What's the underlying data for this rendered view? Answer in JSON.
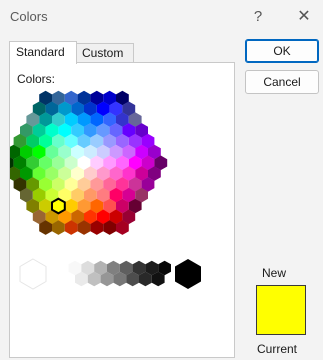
{
  "window": {
    "title": "Colors",
    "help_glyph": "?",
    "close_glyph": "✕"
  },
  "tabs": [
    {
      "label": "Standard",
      "active": true
    },
    {
      "label": "Custom",
      "active": false
    }
  ],
  "palette": {
    "label": "Colors:",
    "selected_color": "#ffff00",
    "hex_rows": [
      [
        "#003366",
        "#336699",
        "#3366cc",
        "#003399",
        "#000099",
        "#0000cc",
        "#000066"
      ],
      [
        "#006666",
        "#006699",
        "#0099cc",
        "#0066cc",
        "#0033cc",
        "#0000ff",
        "#3333ff",
        "#333399"
      ],
      [
        "#669999",
        "#009999",
        "#33cccc",
        "#00ccff",
        "#0099ff",
        "#0066ff",
        "#3366ff",
        "#3333cc",
        "#666699"
      ],
      [
        "#339966",
        "#00cc99",
        "#00ffcc",
        "#00ffff",
        "#33ccff",
        "#3399ff",
        "#6699ff",
        "#6666ff",
        "#6600ff",
        "#6600cc"
      ],
      [
        "#339933",
        "#00cc66",
        "#00ff99",
        "#66ffcc",
        "#66ffff",
        "#66ccff",
        "#99ccff",
        "#9999ff",
        "#9966ff",
        "#9933ff",
        "#9900ff"
      ],
      [
        "#006600",
        "#00cc00",
        "#00ff00",
        "#66ff99",
        "#99ffcc",
        "#ccffff",
        "#ccecff",
        "#ccccff",
        "#cc99ff",
        "#cc66ff",
        "#cc00ff",
        "#9900cc"
      ],
      [
        "#003300",
        "#008000",
        "#33cc33",
        "#66ff66",
        "#99ff99",
        "#ccffcc",
        "#ffffff",
        "#ffccff",
        "#ff99ff",
        "#ff66ff",
        "#ff00ff",
        "#cc00cc",
        "#660066"
      ],
      [
        "#336600",
        "#009900",
        "#66ff33",
        "#99ff66",
        "#ccff99",
        "#ffffcc",
        "#ffcccc",
        "#ff99cc",
        "#ff66cc",
        "#ff33cc",
        "#cc0099",
        "#800080"
      ],
      [
        "#333300",
        "#669900",
        "#99ff33",
        "#ccff66",
        "#ffff99",
        "#ffcc99",
        "#ff9999",
        "#ff6699",
        "#ff3399",
        "#cc3399",
        "#990099"
      ],
      [
        "#666633",
        "#99cc00",
        "#ccff33",
        "#ffff66",
        "#ffcc66",
        "#ff9966",
        "#ff7c80",
        "#ff0066",
        "#d60093",
        "#993366"
      ],
      [
        "#808000",
        "#cccc00",
        "#ffff00",
        "#ffcc00",
        "#ff9933",
        "#ff6600",
        "#ff5050",
        "#cc0066",
        "#660033"
      ],
      [
        "#996633",
        "#cc9900",
        "#ff9900",
        "#cc6600",
        "#ff3300",
        "#ff0000",
        "#cc0000",
        "#990033"
      ],
      [
        "#663300",
        "#996600",
        "#cc3300",
        "#993300",
        "#990000",
        "#800000",
        "#a50021"
      ]
    ],
    "gray_big_left": "#ffffff",
    "gray_big_right": "#000000",
    "gray_row_top": [
      "#f8f8f8",
      "#dddddd",
      "#b2b2b2",
      "#808080",
      "#5f5f5f",
      "#333333",
      "#1c1c1c",
      "#080808"
    ],
    "gray_row_bottom": [
      "#eaeaea",
      "#c0c0c0",
      "#969696",
      "#777777",
      "#4d4d4d",
      "#292929",
      "#111111"
    ]
  },
  "buttons": {
    "ok": "OK",
    "cancel": "Cancel"
  },
  "preview": {
    "new_label": "New",
    "current_label": "Current",
    "color": "#ffff00"
  }
}
